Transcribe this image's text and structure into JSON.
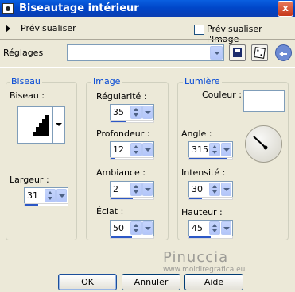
{
  "window": {
    "title": "Biseautage intérieur",
    "close_label": "x"
  },
  "preview": {
    "label": "Prévisualiser",
    "image_preview_label": "Prévisualiser l'image"
  },
  "presets": {
    "label": "Réglages",
    "value": ""
  },
  "groups": {
    "bevel": "Biseau",
    "image": "Image",
    "light": "Lumière"
  },
  "bevel": {
    "shape_label": "Biseau :",
    "width": {
      "label": "Largeur :",
      "value": "31",
      "level": 0.31
    }
  },
  "image": {
    "smoothness": {
      "label": "Régularité :",
      "value": "35",
      "level": 0.35
    },
    "depth": {
      "label": "Profondeur :",
      "value": "12",
      "level": 0.12
    },
    "ambience": {
      "label": "Ambiance :",
      "value": "2",
      "level": 0.52
    },
    "shininess": {
      "label": "Éclat :",
      "value": "50",
      "level": 0.5
    }
  },
  "light": {
    "color_label": "Couleur :",
    "color": "#ffffff",
    "angle": {
      "label": "Angle :",
      "value": "315",
      "level": 0.875
    },
    "intensity": {
      "label": "Intensité :",
      "value": "30",
      "level": 0.3
    },
    "elevation": {
      "label": "Hauteur :",
      "value": "45",
      "level": 0.5
    }
  },
  "watermark": {
    "line1": "Pinuccia",
    "line2": "www.moidiregrafica.eu"
  },
  "buttons": {
    "ok": "OK",
    "cancel": "Annuler",
    "help": "Aide"
  },
  "colors": {
    "accent": "#0046d5",
    "bar_fill": "#2b57c6",
    "title_bar": "#0046c8"
  }
}
